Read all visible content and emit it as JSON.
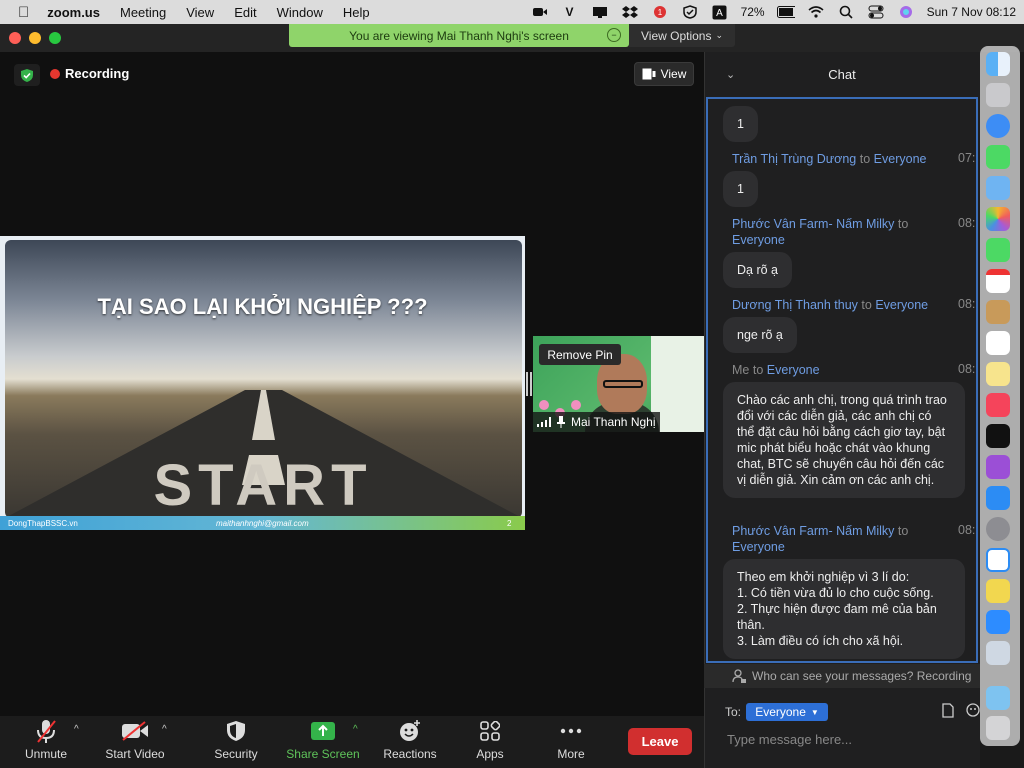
{
  "menubar": {
    "app": "zoom.us",
    "items": [
      "Meeting",
      "View",
      "Edit",
      "Window",
      "Help"
    ],
    "battery": "72%",
    "datetime": "Sun 7 Nov  08:12"
  },
  "banner": {
    "text": "You are viewing Mai Thanh Nghị's screen",
    "view_options": "View Options"
  },
  "stage": {
    "recording": "Recording",
    "view_button": "View"
  },
  "slide": {
    "title": "TẠI SAO LẠI KHỞI NGHIỆP ???",
    "footer_left": "DongThapBSSC.vn",
    "footer_mid": "maithanhnghi@gmail.com",
    "footer_page": "2"
  },
  "participant": {
    "remove_pin": "Remove Pin",
    "name": "Mai Thanh Nghị"
  },
  "toolbar": {
    "unmute": "Unmute",
    "start_video": "Start Video",
    "security": "Security",
    "share_screen": "Share Screen",
    "reactions": "Reactions",
    "apps": "Apps",
    "more": "More",
    "leave": "Leave"
  },
  "chat": {
    "header": "Chat",
    "messages": [
      {
        "bubble": "1"
      },
      {
        "sender": "Trần Thị Trùng Dương",
        "to": "to",
        "recipient": "Everyone",
        "time": "07:",
        "bubble": "1"
      },
      {
        "sender": "Phước Vân Farm- Nấm Milky",
        "to": "to",
        "recipient": "Everyone",
        "time": "08:",
        "bubble": "Dạ rõ ạ"
      },
      {
        "sender": "Dương Thị Thanh thuy",
        "to": "to",
        "recipient": "Everyone",
        "time": "08:",
        "bubble": "nge rõ ạ"
      },
      {
        "sender": "Me",
        "to": "to",
        "recipient": "Everyone",
        "time": "08:",
        "bubble": "Chào các anh chị, trong quá trình trao đổi với các diễn giả, các anh chị có thể đặt câu hỏi bằng cách giơ tay, bật mic phát biểu hoặc chát vào khung chat, BTC sẽ chuyển câu hỏi đến các vị diễn giả. Xin cảm ơn các anh chị."
      },
      {
        "sender": "Phước Vân Farm- Nấm Milky",
        "to": "to",
        "recipient": "Everyone",
        "time": "08:",
        "bubble": "Theo em khởi nghiệp vì 3 lí do:\n1. Có tiền vừa đủ lo cho cuộc sống.\n2. Thực hiện được đam mê của bản thân.\n3. Làm điều có ích cho xã hội."
      }
    ],
    "who_can_see": "Who can see your messages? Recording",
    "to_label": "To:",
    "to_value": "Everyone",
    "placeholder": "Type message here..."
  },
  "colors": {
    "banner": "#8fd46a",
    "leave": "#d12f2f",
    "link": "#6f9de3",
    "recipient_select": "#2d6fd6"
  }
}
